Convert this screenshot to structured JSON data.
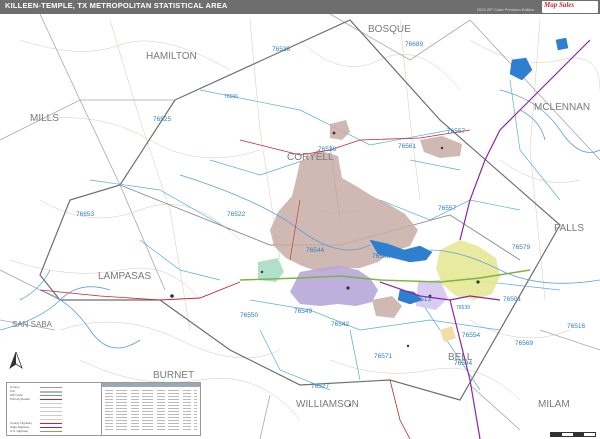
{
  "header": {
    "title": "KILLEEN-TEMPLE, TX METROPOLITAN STATISTICAL AREA",
    "edition": "2023 ZIP Code Premium Edition",
    "logo": "Map Sales"
  },
  "counties": [
    {
      "name": "BOSQUE",
      "role": "neighbor"
    },
    {
      "name": "HAMILTON",
      "role": "neighbor"
    },
    {
      "name": "MCLENNAN",
      "role": "neighbor"
    },
    {
      "name": "MILLS",
      "role": "neighbor"
    },
    {
      "name": "CORYELL",
      "role": "metro"
    },
    {
      "name": "FALLS",
      "role": "neighbor"
    },
    {
      "name": "LAMPASAS",
      "role": "metro"
    },
    {
      "name": "SAN SABA",
      "role": "neighbor"
    },
    {
      "name": "BURNET",
      "role": "neighbor"
    },
    {
      "name": "BELL",
      "role": "metro"
    },
    {
      "name": "WILLIAMSON",
      "role": "neighbor"
    },
    {
      "name": "MILAM",
      "role": "neighbor"
    }
  ],
  "zip_codes": [
    "76689",
    "76538",
    "76566",
    "76525",
    "76557",
    "76528",
    "76561",
    "76853",
    "76522",
    "76557",
    "76579",
    "76544",
    "76543",
    "76501",
    "76550",
    "76539",
    "76549",
    "76542",
    "76513",
    "76554",
    "76516",
    "76569",
    "76534",
    "76571",
    "76527"
  ],
  "legend": {
    "rows": [
      "County",
      "City",
      "ZIP Code",
      "Primary Roads",
      "",
      "",
      "",
      "",
      "",
      "County Highway",
      "State Highway",
      "U.S. Highway",
      "Interstate"
    ]
  },
  "colors": {
    "fort_hood": "#c8aca6",
    "killeen": "#b8a6d8",
    "temple": "#e6e896",
    "water": "#2f7fd1",
    "zip_border": "#4aa3d6",
    "county_border": "#9a9a9a",
    "metro_boundary": "#6f6f6f",
    "zip_label": "#2d7fc0",
    "highway": "#8e24aa",
    "us_highway": "#7cb342"
  }
}
